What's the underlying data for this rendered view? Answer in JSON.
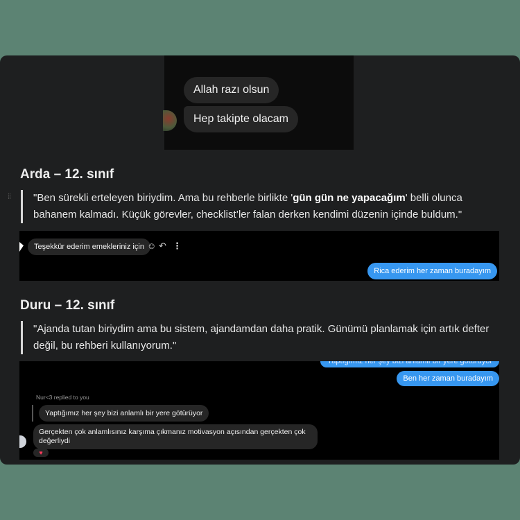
{
  "screenshot1": {
    "messages": [
      "Allah razı olsun",
      "Hep takipte olacam"
    ]
  },
  "testimonials": [
    {
      "name": "Arda – 12. sınıf",
      "quote_before": "\"Ben sürekli erteleyen biriydim. Ama bu rehberle birlikte '",
      "quote_bold": "gün gün ne yapacağım",
      "quote_after": "' belli olunca bahanem kalmadı. Küçük görevler, checklist’ler falan derken kendimi düzenin içinde buldum.\""
    },
    {
      "name": "Duru – 12. sınıf",
      "quote": "\"Ajanda tutan biriydim ama bu sistem, ajandamdan daha pratik. Günümü planlamak için artık defter değil, bu rehberi kullanıyorum.\""
    }
  ],
  "screenshot2": {
    "received": "Teşekkür ederim emekleriniz için",
    "icons": {
      "react": "☺",
      "reply": "↶",
      "more": "⋮"
    },
    "sent": "Rica ederim her zaman buradayım"
  },
  "screenshot3": {
    "sent_partial": "Yaptığımız her şey bizi anlamlı bir yere götürüyor",
    "sent": "Ben her zaman buradayım",
    "replied_to": "Nur<3 replied to you",
    "quoted": "Yaptığımız her şey bizi anlamlı bir yere götürüyor",
    "received": "Gerçekten çok anlamlısınız karşıma çıkmanız motivasyon açısından gerçekten çok değerliydi",
    "reaction": "♥"
  },
  "colors": {
    "background": "#5c8373",
    "card": "#1e1f20",
    "sent_bubble": "#3797f0",
    "received_bubble": "#262626"
  }
}
